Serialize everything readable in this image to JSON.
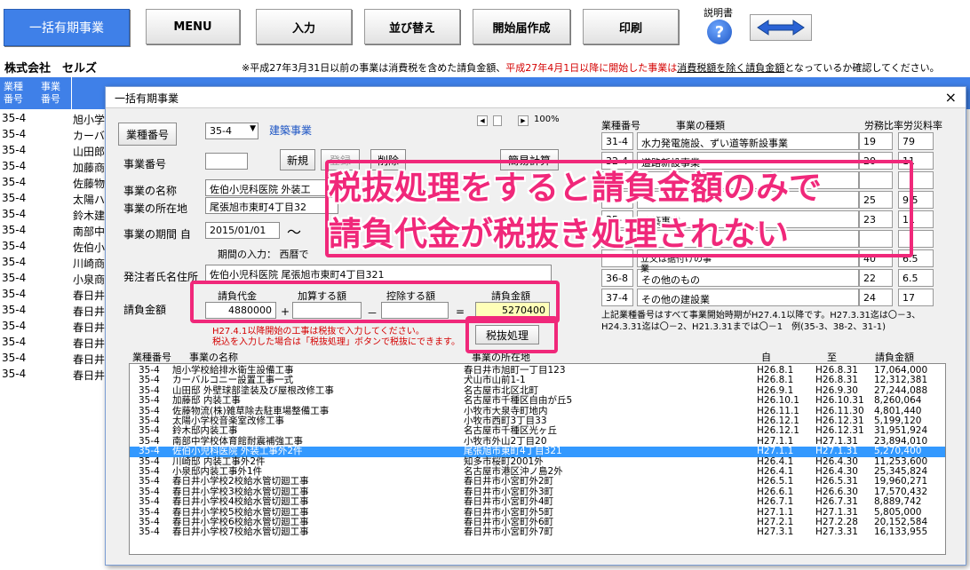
{
  "toolbar": {
    "main": "一括有期事業",
    "menu": "MENU",
    "input": "入力",
    "sort": "並び替え",
    "start_report": "開始届作成",
    "print": "印刷",
    "help_label": "説明書",
    "help_glyph": "?"
  },
  "company": "株式会社　セルズ",
  "notice": {
    "p1": "※平成27年3月31日以前の事業は消費税を含めた請負金額、",
    "p2": "平成27年4月1日以降に開始した事業は",
    "p3": "消費税額を除く請負金額",
    "p4": "となっているか確認してください。"
  },
  "bg": {
    "h_type": "業種番号",
    "h_no": "事業番号",
    "rows": [
      {
        "t": "35-4",
        "n": "旭小学"
      },
      {
        "t": "35-4",
        "n": "カーバ"
      },
      {
        "t": "35-4",
        "n": "山田郎"
      },
      {
        "t": "35-4",
        "n": "加藤商"
      },
      {
        "t": "35-4",
        "n": "佐藤物流"
      },
      {
        "t": "35-4",
        "n": "太陽ハ"
      },
      {
        "t": "35-4",
        "n": "鈴木建"
      },
      {
        "t": "35-4",
        "n": "南部中"
      },
      {
        "t": "35-4",
        "n": "佐伯小"
      },
      {
        "t": "35-4",
        "n": "川崎商"
      },
      {
        "t": "35-4",
        "n": "小泉商"
      },
      {
        "t": "35-4",
        "n": "春日井"
      },
      {
        "t": "35-4",
        "n": "春日井"
      },
      {
        "t": "35-4",
        "n": "春日井"
      },
      {
        "t": "35-4",
        "n": "春日井"
      },
      {
        "t": "35-4",
        "n": "春日井"
      },
      {
        "t": "35-4",
        "n": "春日井"
      }
    ]
  },
  "dialog": {
    "title": "一括有期事業",
    "close": "×",
    "btn_type": "業種番号",
    "type_val": "35-4",
    "type_name": "建築事業",
    "zoom": "100%",
    "lbl_no": "事業番号",
    "btn_new": "新規",
    "btn_reg": "登録",
    "btn_del": "削除",
    "btn_calc": "簡易計算",
    "lbl_name": "事業の名称",
    "name_val": "佐伯小児科医院 外装工",
    "lbl_addr": "事業の所在地",
    "addr_val": "尾張旭市東町4丁目32",
    "lbl_period": "事業の期間 自",
    "period_from": "2015/01/01",
    "tilde": "～",
    "period_hint": "期間の入力： 西暦で",
    "lbl_orderer": "発注者氏名住所",
    "orderer_val": "佐伯小児科医院 尾張旭市東町4丁目321",
    "lbl_amount": "請負金額",
    "h_contract": "請負代金",
    "h_add": "加算する額",
    "h_sub": "控除する額",
    "h_total": "請負金額",
    "contract_val": "4880000",
    "plus": "+",
    "minus": "－",
    "eq": "=",
    "total_val": "5270400",
    "warn1": "H27.4.1以降開始の工事は税抜で入力してください。",
    "warn2": "税込を入力した場合は「税抜処理」ボタンで税抜にできます。",
    "btn_tax": "税抜処理",
    "tbl_h": {
      "no": "業種番号",
      "kind": "事業の種類",
      "labor": "労務比率",
      "acc": "労災料率"
    },
    "tbl_rows": [
      {
        "no": "31-4",
        "kind": "水力発電施設、ずい道等新設事業",
        "labor": "19",
        "acc": "79"
      },
      {
        "no": "32-4",
        "kind": "道路新設事業",
        "labor": "20",
        "acc": "11"
      },
      {
        "no": "",
        "kind": "",
        "labor": "",
        "acc": ""
      },
      {
        "no": "",
        "kind": "",
        "labor": "25",
        "acc": "9.5"
      },
      {
        "no": "35-",
        "kind": "建築事業",
        "labor": "23",
        "acc": "11"
      },
      {
        "no": "",
        "kind": "",
        "labor": "",
        "acc": ""
      },
      {
        "no": "",
        "kind": "",
        "labor": "40",
        "acc": "6.5"
      },
      {
        "no": "36-8",
        "kind": "その他のもの",
        "labor": "22",
        "acc": "6.5"
      },
      {
        "no": "37-4",
        "kind": "その他の建設業",
        "labor": "24",
        "acc": "17"
      }
    ],
    "tbl_side": "立又は据付けの事業",
    "note1": "上記業種番号はすべて事業開始時期がH27.4.1以降です。H27.3.31迄は〇－3、",
    "note2": "H24.3.31迄は〇－2、H21.3.31までは〇－1　例(35-3、38-2、31-1)"
  },
  "overlay": {
    "line1": "税抜処理をすると請負金額のみで",
    "line2": "請負代金が税抜き処理されない"
  },
  "list": {
    "h": {
      "type": "業種番号",
      "name": "事業の名称",
      "addr": "事業の所在地",
      "from": "自",
      "to": "至",
      "amt": "請負金額"
    },
    "rows": [
      {
        "t": "35-4",
        "n": "旭小学校給排水衛生設備工事",
        "a": "春日井市旭町一丁目123",
        "f": "H26.8.1",
        "e": "H26.8.31",
        "m": "17,064,000"
      },
      {
        "t": "35-4",
        "n": "カーバルコニー設置工事一式",
        "a": "犬山市山前1-1",
        "f": "H26.8.1",
        "e": "H26.8.31",
        "m": "12,312,381"
      },
      {
        "t": "35-4",
        "n": "山田邸 外壁球部塗装及び屋根改修工事",
        "a": "名古屋市北区北町",
        "f": "H26.9.1",
        "e": "H26.9.30",
        "m": "27,244,088"
      },
      {
        "t": "35-4",
        "n": "加藤邸 内装工事",
        "a": "名古屋市千種区自由が丘5",
        "f": "H26.10.1",
        "e": "H26.10.31",
        "m": "8,260,064"
      },
      {
        "t": "35-4",
        "n": "佐藤物流(株)雑草除去駐車場整備工事",
        "a": "小牧市大泉寺町地内",
        "f": "H26.11.1",
        "e": "H26.11.30",
        "m": "4,801,440"
      },
      {
        "t": "35-4",
        "n": "太陽小学校音楽室改修工事",
        "a": "小牧市西町3丁目33",
        "f": "H26.12.1",
        "e": "H26.12.31",
        "m": "5,199,120"
      },
      {
        "t": "35-4",
        "n": "鈴木邸内装工事",
        "a": "名古屋市千種区光ヶ丘",
        "f": "H26.12.1",
        "e": "H26.12.31",
        "m": "31,951,924"
      },
      {
        "t": "35-4",
        "n": "南部中学校体育館耐震補強工事",
        "a": "小牧市外山2丁目20",
        "f": "H27.1.1",
        "e": "H27.1.31",
        "m": "23,894,010"
      },
      {
        "t": "35-4",
        "n": "佐伯小児科医院 外装工事外2件",
        "a": "尾張旭市東町4丁目321",
        "f": "H27.1.1",
        "e": "H27.1.31",
        "m": "5,270,400",
        "sel": true
      },
      {
        "t": "35-4",
        "n": "川崎邸 内装工事外2件",
        "a": "知多市桜町2001外",
        "f": "H26.4.1",
        "e": "H26.4.30",
        "m": "11,253,600"
      },
      {
        "t": "35-4",
        "n": "小泉邸内装工事外1件",
        "a": "名古屋市港区沖ノ島2外",
        "f": "H26.4.1",
        "e": "H26.4.30",
        "m": "25,345,824"
      },
      {
        "t": "35-4",
        "n": "春日井小学校2校給水管切廻工事",
        "a": "春日井市小宮町外2町",
        "f": "H26.5.1",
        "e": "H26.5.31",
        "m": "19,960,271"
      },
      {
        "t": "35-4",
        "n": "春日井小学校3校給水管切廻工事",
        "a": "春日井市小宮町外3町",
        "f": "H26.6.1",
        "e": "H26.6.30",
        "m": "17,570,432"
      },
      {
        "t": "35-4",
        "n": "春日井小学校4校給水管切廻工事",
        "a": "春日井市小宮町外4町",
        "f": "H26.7.1",
        "e": "H26.7.31",
        "m": "8,889,742"
      },
      {
        "t": "35-4",
        "n": "春日井小学校5校給水管切廻工事",
        "a": "春日井市小宮町外5町",
        "f": "H27.1.1",
        "e": "H27.1.31",
        "m": "5,805,000"
      },
      {
        "t": "35-4",
        "n": "春日井小学校6校給水管切廻工事",
        "a": "春日井市小宮町外6町",
        "f": "H27.2.1",
        "e": "H27.2.28",
        "m": "20,152,584"
      },
      {
        "t": "35-4",
        "n": "春日井小学校7校給水管切廻工事",
        "a": "春日井市小宮町外7町",
        "f": "H27.3.1",
        "e": "H27.3.31",
        "m": "16,133,955"
      }
    ]
  },
  "colors": {
    "accent": "#3f80e8",
    "highlight": "#f0287a",
    "warn": "#d40000",
    "selected": "#3399ff",
    "total_bg": "#ffffb8"
  }
}
